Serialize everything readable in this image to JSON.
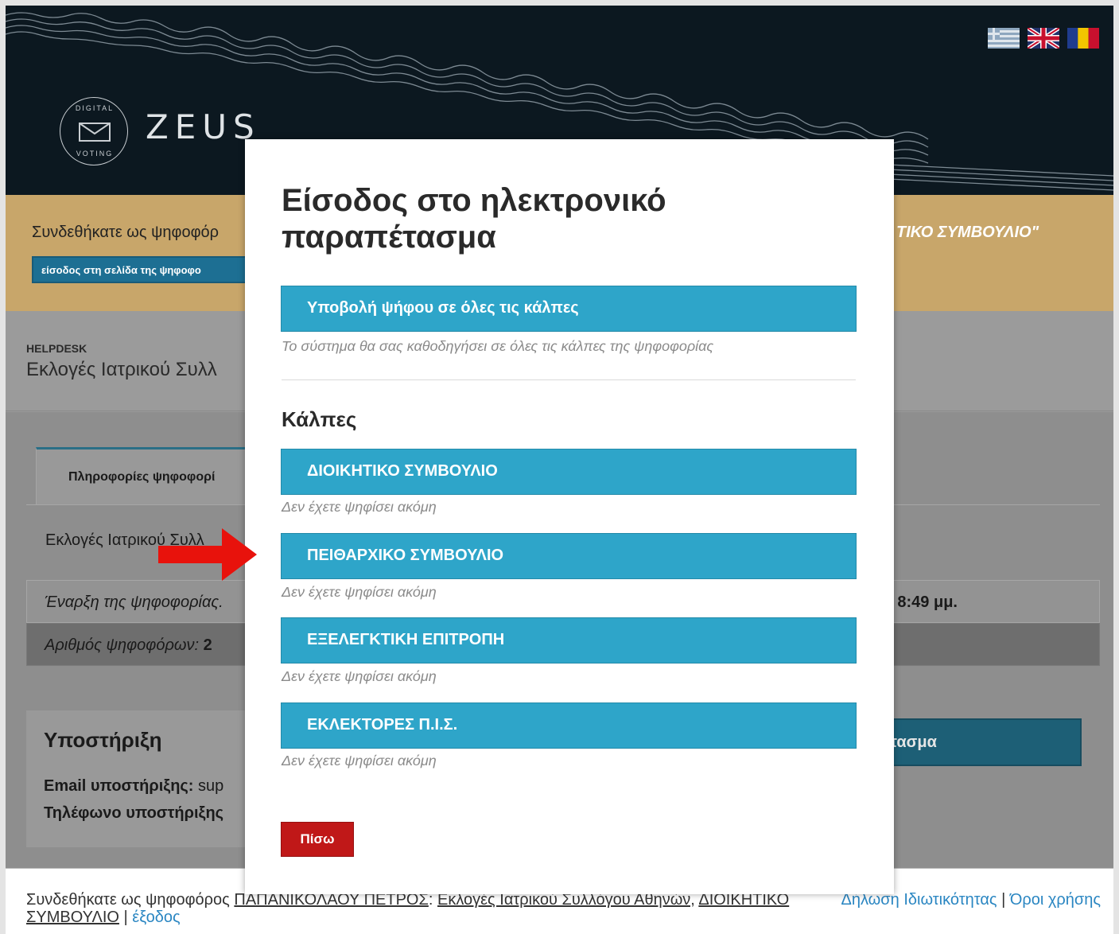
{
  "header": {
    "logo_text": "ZEUS",
    "logo_ring_top": "DIGITAL",
    "logo_ring_bottom": "VOTING",
    "languages": [
      "Ελληνικά",
      "English",
      "Română"
    ]
  },
  "voter_bar": {
    "message_left": "Συνδεθήκατε ως ψηφοφόρ",
    "message_right": "ΤΙΚΟ ΣΥΜΒΟΥΛΙΟ\"",
    "enter_button": "είσοδος στη σελίδα της ψηφοφο"
  },
  "breadcrumb": {
    "label": "HELPDESK",
    "title": "Εκλογές Ιατρικού Συλλ"
  },
  "content": {
    "tab_label": "Πληροφορίες ψηφοφορί",
    "election_name": "Εκλογές Ιατρικού Συλλ",
    "start_label": "Έναρξη της ψηφοφορίας.",
    "start_value": "8:49 μμ.",
    "voters_label": "Αριθμός ψηφοφόρων:",
    "voters_count": "2",
    "booth_button": "τασμα"
  },
  "support": {
    "title": "Υποστήριξη",
    "email_label": "Email υποστήριξης:",
    "email_value": "sup",
    "phone_label": "Τηλέφωνο υποστήριξης"
  },
  "footer": {
    "text_prefix": "Συνδεθήκατε ως ψηφοφόρος",
    "voter_name": "ΠΑΠΑΝΙΚΟΛΑΟΥ ΠΕΤΡΟΣ",
    "separator": ":",
    "election_link": "Εκλογές Ιατρικού Συλλόγου Αθηνών,",
    "poll_link": "ΔΙΟΙΚΗΤΙΚΟ ΣΥΜΒΟΥΛΙΟ",
    "pipe": "|",
    "logout": "έξοδος",
    "privacy": "Δήλωση Ιδιωτικότητας",
    "terms": "Όροι χρήσης"
  },
  "modal": {
    "title": "Είσοδος στο ηλεκτρονικό παραπέτασμα",
    "all_polls_button": "Υποβολή ψήφου σε όλες τις κάλπες",
    "all_polls_note": "Το σύστημα θα σας καθοδηγήσει σε όλες τις κάλπες της ψηφοφορίας",
    "polls_heading": "Κάλπες",
    "polls": [
      {
        "label": "ΔΙΟΙΚΗΤΙΚΟ ΣΥΜΒΟΥΛΙΟ",
        "status": "Δεν έχετε ψηφίσει ακόμη"
      },
      {
        "label": "ΠΕΙΘΑΡΧΙΚΟ ΣΥΜΒΟΥΛΙΟ",
        "status": "Δεν έχετε ψηφίσει ακόμη"
      },
      {
        "label": "ΕΞΕΛΕΓΚΤΙΚΗ ΕΠΙΤΡΟΠΗ",
        "status": "Δεν έχετε ψηφίσει ακόμη"
      },
      {
        "label": "ΕΚΛΕΚΤΟΡΕΣ Π.Ι.Σ.",
        "status": "Δεν έχετε ψηφίσει ακόμη"
      }
    ],
    "back_button": "Πίσω"
  },
  "colors": {
    "header_bg": "#0c1820",
    "voter_bar_bg": "#c8a66a",
    "poll_button": "#2ea5c9",
    "back_button": "#c01818",
    "annotation_arrow": "#e8120c"
  }
}
